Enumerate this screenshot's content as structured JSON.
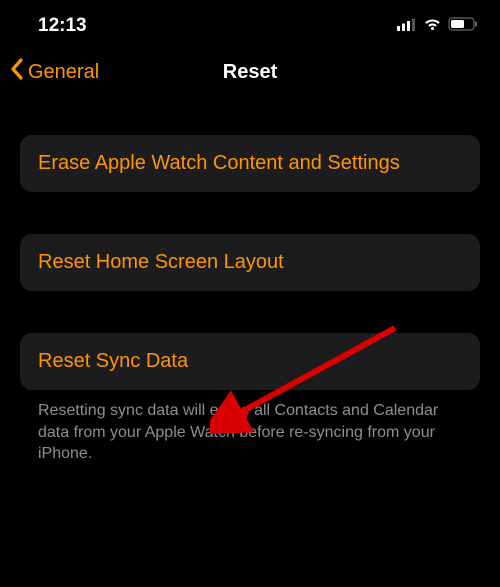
{
  "status_bar": {
    "time": "12:13"
  },
  "nav": {
    "back_label": "General",
    "title": "Reset"
  },
  "options": {
    "erase": "Erase Apple Watch Content and Settings",
    "reset_layout": "Reset Home Screen Layout",
    "reset_sync": "Reset Sync Data"
  },
  "footer": "Resetting sync data will erase all Contacts and Calendar data from your Apple Watch before re-syncing from your iPhone."
}
